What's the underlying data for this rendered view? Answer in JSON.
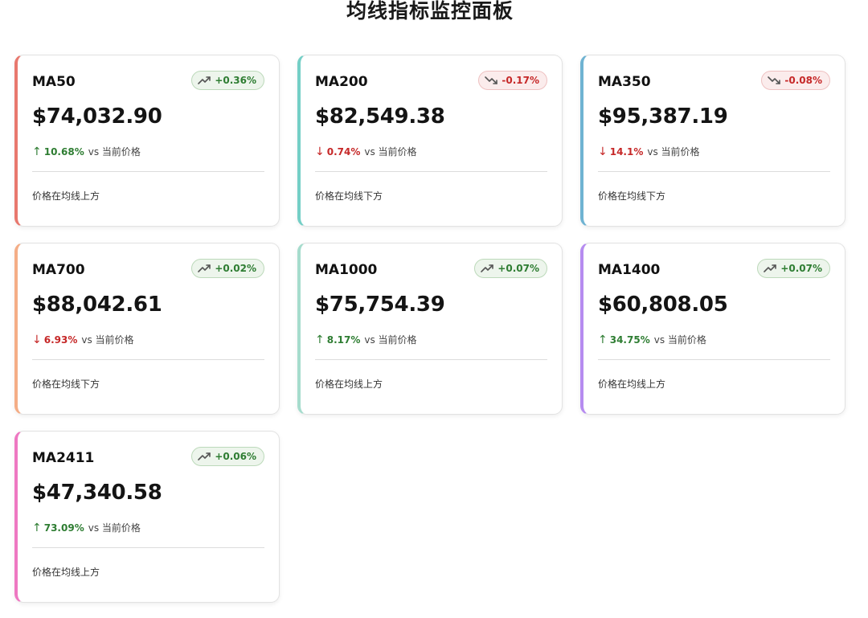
{
  "page": {
    "title": "均线指标监控面板"
  },
  "cards": [
    {
      "name": "MA50",
      "price": "$74,032.90",
      "change": "+0.36%",
      "trend": "up",
      "diff_arrow": "↑",
      "diff_pct": "10.68%",
      "diff_dir": "up",
      "vs_label": "vs 当前价格",
      "status": "价格在均线上方",
      "accent": "#e8786e"
    },
    {
      "name": "MA200",
      "price": "$82,549.38",
      "change": "-0.17%",
      "trend": "down",
      "diff_arrow": "↓",
      "diff_pct": "0.74%",
      "diff_dir": "down",
      "vs_label": "vs 当前价格",
      "status": "价格在均线下方",
      "accent": "#74cfc6"
    },
    {
      "name": "MA350",
      "price": "$95,387.19",
      "change": "-0.08%",
      "trend": "down",
      "diff_arrow": "↓",
      "diff_pct": "14.1%",
      "diff_dir": "down",
      "vs_label": "vs 当前价格",
      "status": "价格在均线下方",
      "accent": "#6fb3d2"
    },
    {
      "name": "MA700",
      "price": "$88,042.61",
      "change": "+0.02%",
      "trend": "up",
      "diff_arrow": "↓",
      "diff_pct": "6.93%",
      "diff_dir": "down",
      "vs_label": "vs 当前价格",
      "status": "价格在均线下方",
      "accent": "#f4ad86"
    },
    {
      "name": "MA1000",
      "price": "$75,754.39",
      "change": "+0.07%",
      "trend": "up",
      "diff_arrow": "↑",
      "diff_pct": "8.17%",
      "diff_dir": "up",
      "vs_label": "vs 当前价格",
      "status": "价格在均线上方",
      "accent": "#a6dccd"
    },
    {
      "name": "MA1400",
      "price": "$60,808.05",
      "change": "+0.07%",
      "trend": "up",
      "diff_arrow": "↑",
      "diff_pct": "34.75%",
      "diff_dir": "up",
      "vs_label": "vs 当前价格",
      "status": "价格在均线上方",
      "accent": "#b68cf0"
    },
    {
      "name": "MA2411",
      "price": "$47,340.58",
      "change": "+0.06%",
      "trend": "up",
      "diff_arrow": "↑",
      "diff_pct": "73.09%",
      "diff_dir": "up",
      "vs_label": "vs 当前价格",
      "status": "价格在均线上方",
      "accent": "#ee78c2"
    }
  ],
  "icons": {
    "up": "trending-up-icon",
    "down": "trending-down-icon"
  }
}
